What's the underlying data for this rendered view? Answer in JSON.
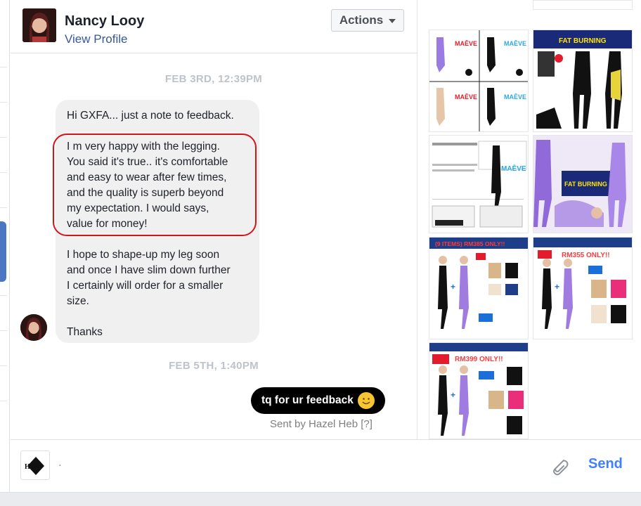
{
  "header": {
    "name": "Nancy Looy",
    "view_profile": "View Profile",
    "actions_label": "Actions"
  },
  "conversation": {
    "timestamp_1": "FEB 3RD, 12:39PM",
    "incoming_message": {
      "line_1": "Hi GXFA... just a note to feedback.",
      "para_2": [
        "I m very happy with the legging.",
        "You said it's true.. it's comfortable",
        "and easy to wear after few times,",
        "and the quality is superb beyond",
        "my expectation. I would says,",
        "value for money!"
      ],
      "para_3": [
        "I hope to shape-up my leg soon",
        "and once I have slim down further",
        "I certainly will order for a smaller",
        "size."
      ],
      "closing": "Thanks"
    },
    "timestamp_2": "FEB 5TH, 1:40PM",
    "outgoing_message": "tq for ur feedback",
    "sent_by": "Sent by Hazel Heb [?]"
  },
  "composer": {
    "input_text": ".",
    "send_label": "Send",
    "logo_text": "HEB"
  },
  "image_thumbnails": [
    {
      "name": "maeve-compression-grid",
      "text": "MAĒVE"
    },
    {
      "name": "fat-burning-legging-ad",
      "text": "FAT BURNING"
    },
    {
      "name": "maeve-product-sheet",
      "text": "MAĒVE"
    },
    {
      "name": "fat-burning-slim-legging",
      "text": "FAT BURNING"
    },
    {
      "name": "9-items-rm385-promo",
      "text": "(9 ITEMS) RM385 ONLY!!"
    },
    {
      "name": "rm355-promo",
      "text": "RM355 ONLY!!"
    },
    {
      "name": "rm399-promo",
      "text": "RM399 ONLY!!"
    }
  ],
  "colors": {
    "accent": "#4080ff",
    "link": "#365899",
    "highlight": "#d0161d",
    "outgoing_bubble": "#000000"
  }
}
